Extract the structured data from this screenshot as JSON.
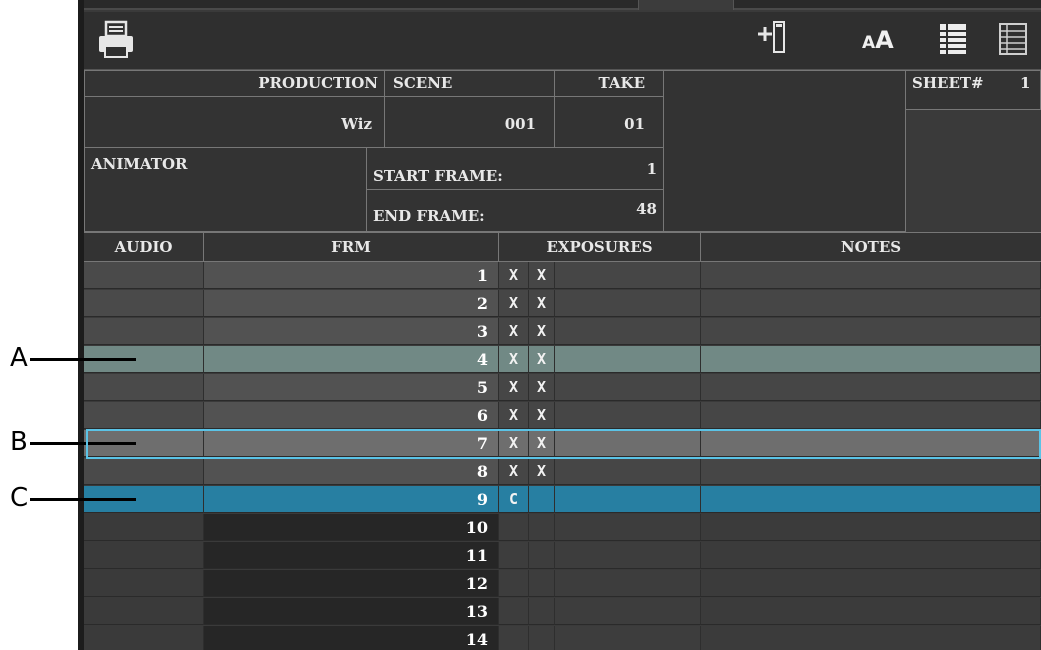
{
  "header": {
    "production_label": "PRODUCTION",
    "production_value": "Wiz",
    "scene_label": "SCENE",
    "scene_value": "001",
    "take_label": "TAKE",
    "take_value": "01",
    "sheet_label": "SHEET#",
    "sheet_value": "1",
    "animator_label": "ANIMATOR",
    "start_frame_label": "START FRAME:",
    "start_frame_value": "1",
    "end_frame_label": "END FRAME:",
    "end_frame_value": "48"
  },
  "columns": {
    "audio": "AUDIO",
    "frm": "FRM",
    "exposures": "EXPOSURES",
    "notes": "NOTES"
  },
  "rows": [
    {
      "frame": "1",
      "exp1": "X",
      "exp2": "X",
      "state": "exposed"
    },
    {
      "frame": "2",
      "exp1": "X",
      "exp2": "X",
      "state": "exposed"
    },
    {
      "frame": "3",
      "exp1": "X",
      "exp2": "X",
      "state": "exposed"
    },
    {
      "frame": "4",
      "exp1": "X",
      "exp2": "X",
      "state": "current"
    },
    {
      "frame": "5",
      "exp1": "X",
      "exp2": "X",
      "state": "exposed"
    },
    {
      "frame": "6",
      "exp1": "X",
      "exp2": "X",
      "state": "exposed"
    },
    {
      "frame": "7",
      "exp1": "X",
      "exp2": "X",
      "state": "hover"
    },
    {
      "frame": "8",
      "exp1": "X",
      "exp2": "X",
      "state": "exposed"
    },
    {
      "frame": "9",
      "exp1": "C",
      "exp2": "",
      "state": "selected"
    },
    {
      "frame": "10",
      "exp1": "",
      "exp2": "",
      "state": "empty"
    },
    {
      "frame": "11",
      "exp1": "",
      "exp2": "",
      "state": "empty"
    },
    {
      "frame": "12",
      "exp1": "",
      "exp2": "",
      "state": "empty"
    },
    {
      "frame": "13",
      "exp1": "",
      "exp2": "",
      "state": "empty"
    },
    {
      "frame": "14",
      "exp1": "",
      "exp2": "",
      "state": "empty"
    }
  ],
  "callouts": [
    {
      "label": "A",
      "row_index": 3
    },
    {
      "label": "B",
      "row_index": 6
    },
    {
      "label": "C",
      "row_index": 8
    }
  ],
  "icons": [
    "printer-icon",
    "add-column-icon",
    "font-size-icon",
    "sheet-view-filled-icon",
    "sheet-view-outline-icon"
  ],
  "colors": {
    "current_row": "#718985",
    "hover_row": "#6e6e6e",
    "hover_outline": "#5bc3e6",
    "selected_row": "#277fa2",
    "exposed_row": "#525252",
    "empty_frm": "#262626",
    "empty_row": "#3b3b3b"
  }
}
